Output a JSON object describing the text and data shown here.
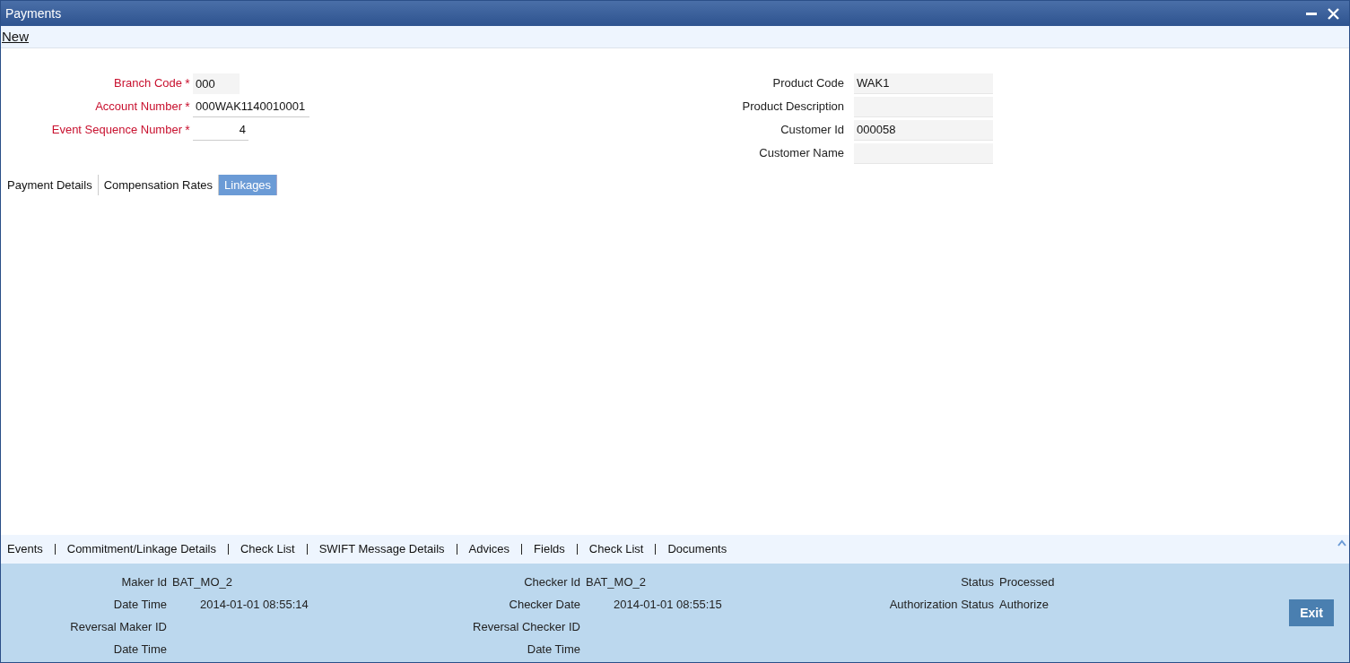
{
  "window": {
    "title": "Payments"
  },
  "toolbar": {
    "items": [
      "New"
    ]
  },
  "header_left": [
    {
      "label": "Branch Code",
      "required": true,
      "marker": "*",
      "value": "000",
      "kind": "shaded"
    },
    {
      "label": "Account Number",
      "required": true,
      "marker": "*",
      "value": "000WAK1140010001",
      "kind": "line"
    },
    {
      "label": "Event Sequence Number",
      "required": true,
      "marker": "*",
      "value": "4",
      "kind": "number"
    }
  ],
  "header_right": [
    {
      "label": "Product Code",
      "value": "WAK1"
    },
    {
      "label": "Product Description"
    },
    {
      "label": "Customer Id",
      "value": "000058"
    },
    {
      "label": "Customer Name"
    }
  ],
  "tabs": [
    {
      "label": "Payment Details",
      "selected": false
    },
    {
      "label": "Compensation Rates",
      "selected": false
    },
    {
      "label": "Linkages",
      "selected": true
    }
  ],
  "links": [
    "Events",
    "Commitment/Linkage Details",
    "Check List",
    "SWIFT Message Details",
    "Advices",
    "Fields",
    "Check List",
    "Documents"
  ],
  "audit": [
    [
      {
        "label": "Maker Id",
        "value": "BAT_MO_2"
      },
      {
        "label": "Date Time",
        "value": "2014-01-01 08:55:14"
      },
      {
        "label": "Reversal Maker ID"
      },
      {
        "label": "Date Time"
      }
    ],
    [
      {
        "label": "Checker Id",
        "value": "BAT_MO_2"
      },
      {
        "label": "Checker Date",
        "value": "2014-01-01 08:55:15"
      },
      {
        "label": "Reversal Checker ID"
      },
      {
        "label": "Date Time"
      }
    ],
    [
      {
        "label": "Status",
        "value": "Processed"
      },
      {
        "label": "Authorization Status",
        "value": "Authorize"
      }
    ]
  ],
  "buttons": [
    "Exit"
  ]
}
